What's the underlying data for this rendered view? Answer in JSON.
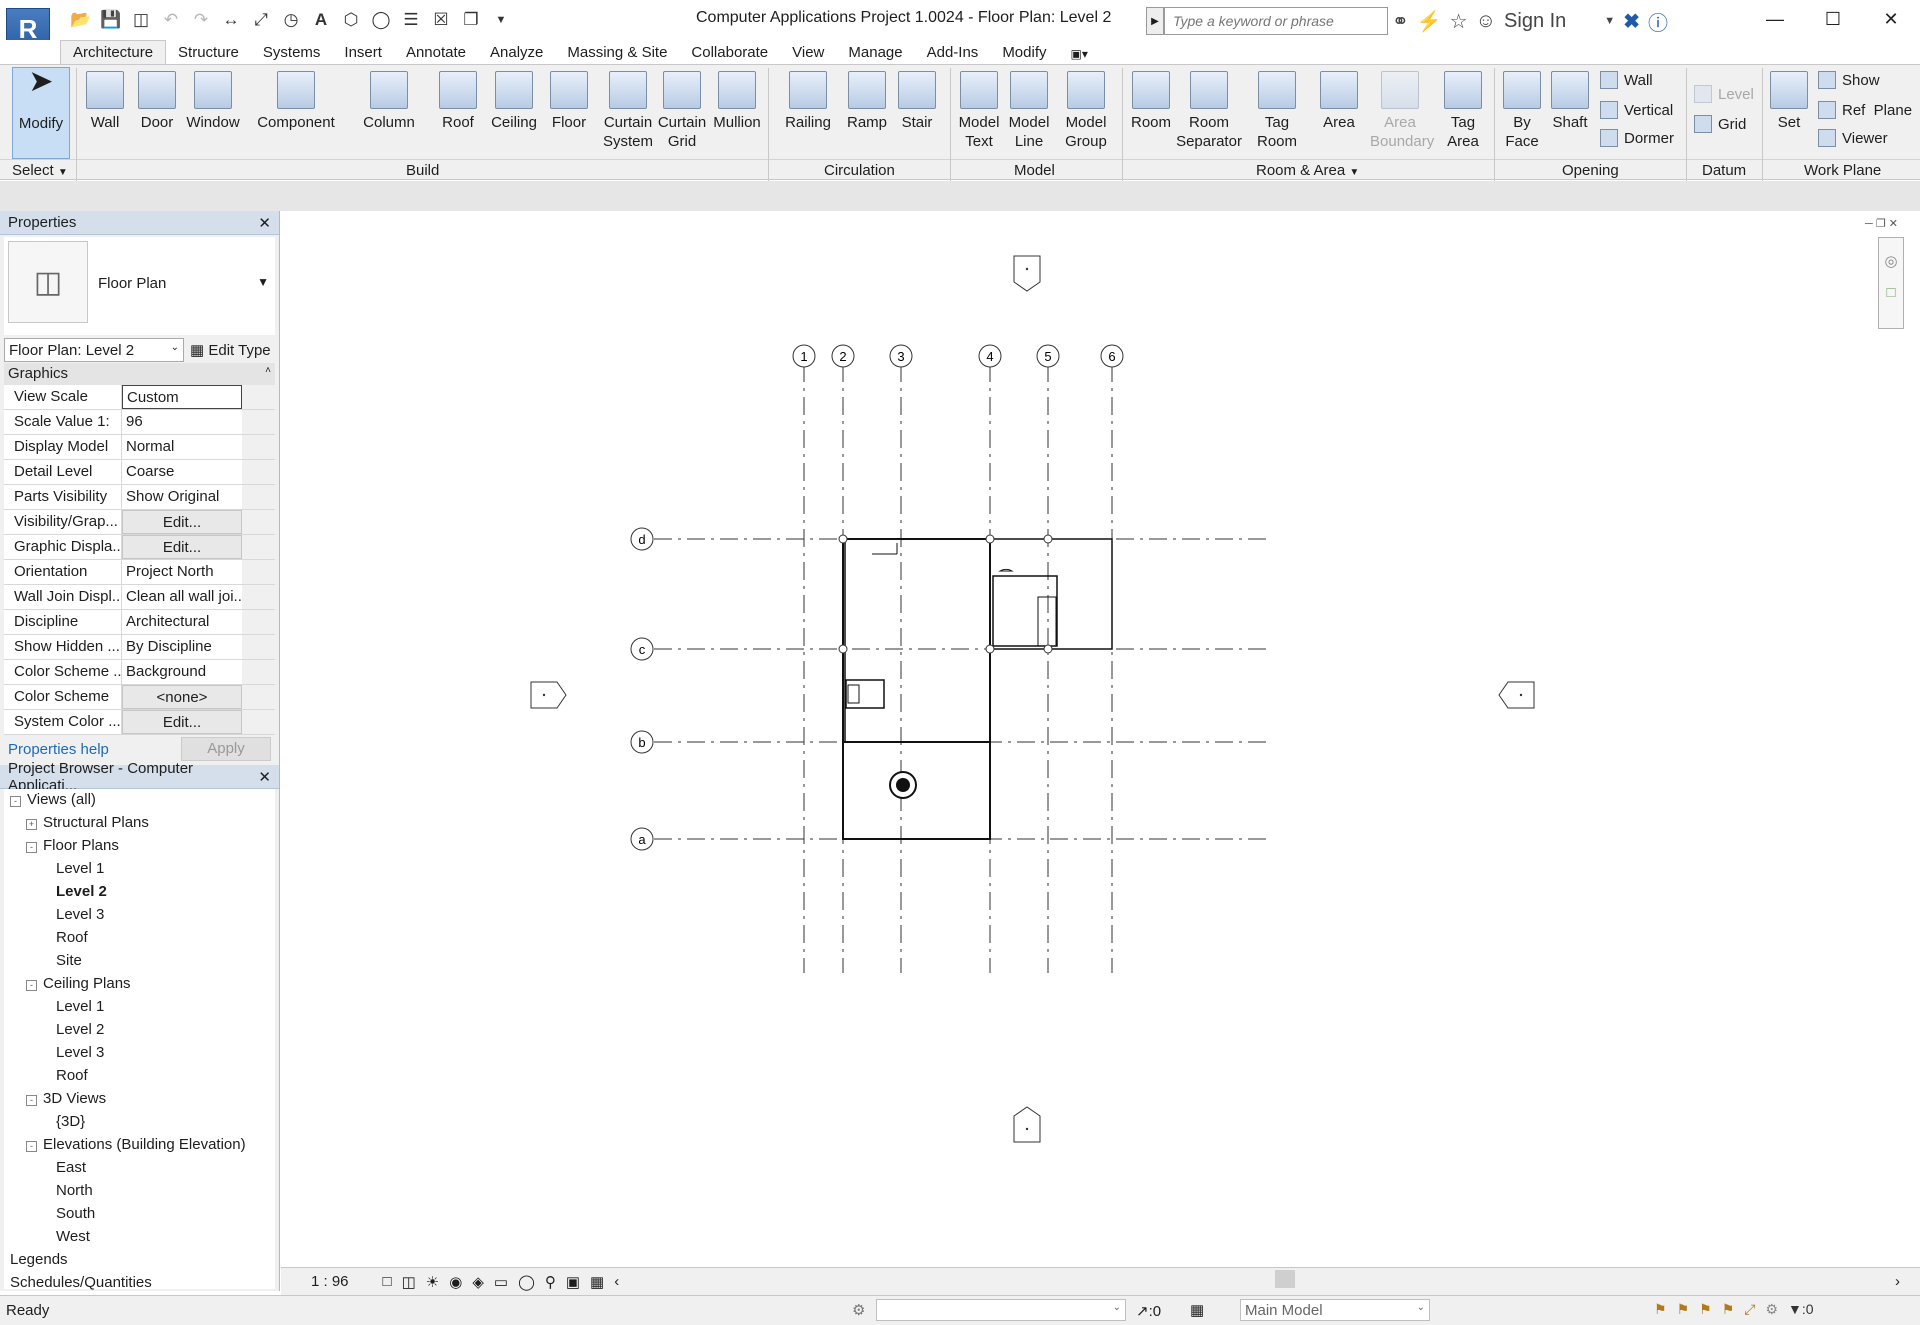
{
  "app": {
    "logo": "R",
    "window_title": "Computer Applications Project 1.0024 - Floor Plan: Level 2",
    "search_placeholder": "Type a keyword or phrase",
    "sign_in": "Sign In"
  },
  "tabs": [
    "Architecture",
    "Structure",
    "Systems",
    "Insert",
    "Annotate",
    "Analyze",
    "Massing & Site",
    "Collaborate",
    "View",
    "Manage",
    "Add-Ins",
    "Modify"
  ],
  "ribbon": {
    "modify": "Modify",
    "select": "Select",
    "build": [
      "Wall",
      "Door",
      "Window",
      "Component",
      "Column",
      "Roof",
      "Ceiling",
      "Floor",
      "Curtain System",
      "Curtain Grid",
      "Mullion"
    ],
    "circulation": [
      "Railing",
      "Ramp",
      "Stair"
    ],
    "model": [
      "Model Text",
      "Model Line",
      "Model Group"
    ],
    "room_area": [
      "Room",
      "Room Separator",
      "Tag Room",
      "Area",
      "Area Boundary",
      "Tag Area"
    ],
    "opening": [
      "By Face",
      "Shaft",
      "Wall",
      "Vertical",
      "Dormer"
    ],
    "datum": [
      "Level",
      "Grid"
    ],
    "work_plane": [
      "Set",
      "Show",
      "Ref  Plane",
      "Viewer"
    ],
    "panels": [
      "Build",
      "Circulation",
      "Model",
      "Room & Area",
      "Opening",
      "Datum",
      "Work Plane"
    ]
  },
  "properties": {
    "title": "Properties",
    "type_name": "Floor Plan",
    "view_selector": "Floor Plan: Level 2",
    "edit_type": "Edit Type",
    "group": "Graphics",
    "rows": [
      {
        "k": "View Scale",
        "v": "Custom"
      },
      {
        "k": "Scale Value    1:",
        "v": "96"
      },
      {
        "k": "Display Model",
        "v": "Normal"
      },
      {
        "k": "Detail Level",
        "v": "Coarse"
      },
      {
        "k": "Parts Visibility",
        "v": "Show Original"
      },
      {
        "k": "Visibility/Grap...",
        "v": "Edit..."
      },
      {
        "k": "Graphic Displa...",
        "v": "Edit..."
      },
      {
        "k": "Orientation",
        "v": "Project North"
      },
      {
        "k": "Wall Join Displ...",
        "v": "Clean all wall joi..."
      },
      {
        "k": "Discipline",
        "v": "Architectural"
      },
      {
        "k": "Show Hidden ...",
        "v": "By Discipline"
      },
      {
        "k": "Color Scheme ...",
        "v": "Background"
      },
      {
        "k": "Color Scheme",
        "v": "<none>"
      },
      {
        "k": "System Color ...",
        "v": "Edit..."
      }
    ],
    "help": "Properties help",
    "apply": "Apply"
  },
  "browser": {
    "title": "Project Browser - Computer Applicati...",
    "items": [
      {
        "label": "Views (all)"
      },
      {
        "label": "Structural Plans"
      },
      {
        "label": "Floor Plans"
      },
      {
        "label": "Level 1"
      },
      {
        "label": "Level 2"
      },
      {
        "label": "Level 3"
      },
      {
        "label": "Roof"
      },
      {
        "label": "Site"
      },
      {
        "label": "Ceiling Plans"
      },
      {
        "label": "Level 1"
      },
      {
        "label": "Level 2"
      },
      {
        "label": "Level 3"
      },
      {
        "label": "Roof"
      },
      {
        "label": "3D Views"
      },
      {
        "label": "{3D}"
      },
      {
        "label": "Elevations (Building Elevation)"
      },
      {
        "label": "East"
      },
      {
        "label": "North"
      },
      {
        "label": "South"
      },
      {
        "label": "West"
      },
      {
        "label": "Legends"
      },
      {
        "label": "Schedules/Quantities"
      }
    ]
  },
  "drawing": {
    "grid_v": [
      "1",
      "2",
      "3",
      "4",
      "5",
      "6"
    ],
    "grid_h": [
      "d",
      "c",
      "b",
      "a"
    ]
  },
  "view_control": {
    "scale": "1 : 96"
  },
  "status": {
    "ready": "Ready",
    "sel_count": ":0",
    "model": "Main Model",
    "filter_count": ":0"
  }
}
